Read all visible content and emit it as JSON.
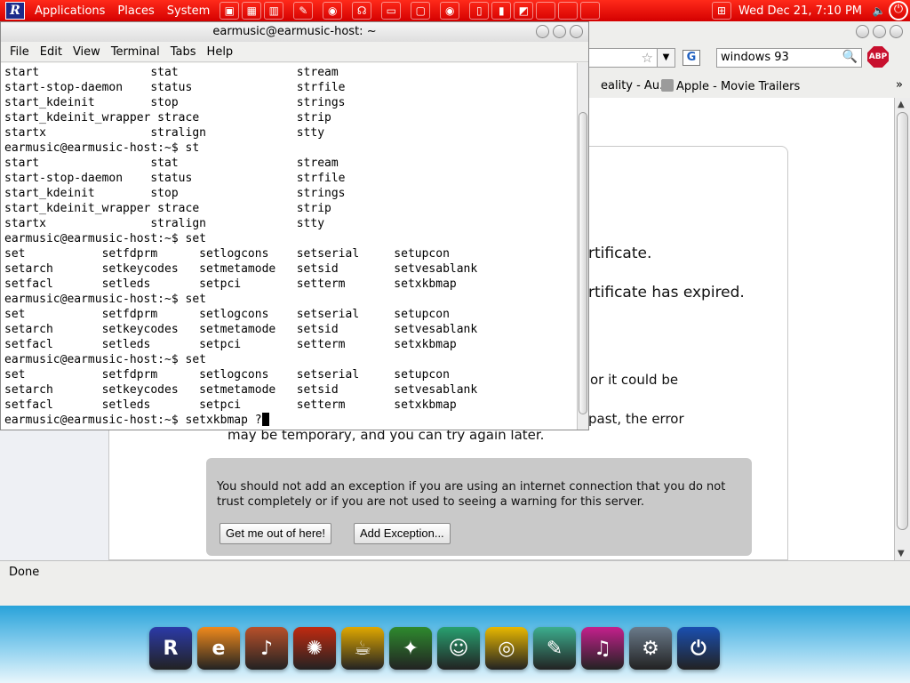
{
  "top_panel": {
    "menus": [
      "Applications",
      "Places",
      "System"
    ],
    "clock": "Wed Dec 21,  7:10 PM",
    "launchers": [
      "screenshot-icon",
      "keyboard-icon",
      "audio-icon",
      "note-icon",
      "firefox-icon",
      "headphones-icon",
      "monitor-icon",
      "window-icon",
      "firefox-icon",
      "paper-icon",
      "trash-icon",
      "document-icon",
      "blank-icon",
      "blank-icon",
      "blank-icon",
      "network-icon",
      "volume-icon"
    ]
  },
  "terminal": {
    "title": "earmusic@earmusic-host: ~",
    "menu": [
      "File",
      "Edit",
      "View",
      "Terminal",
      "Tabs",
      "Help"
    ],
    "lines": [
      "start                stat                 stream",
      "start-stop-daemon    status               strfile",
      "start_kdeinit        stop                 strings",
      "start_kdeinit_wrapper strace              strip",
      "startx               stralign             stty",
      "earmusic@earmusic-host:~$ st",
      "start                stat                 stream",
      "start-stop-daemon    status               strfile",
      "start_kdeinit        stop                 strings",
      "start_kdeinit_wrapper strace              strip",
      "startx               stralign             stty",
      "earmusic@earmusic-host:~$ set",
      "set           setfdprm      setlogcons    setserial     setupcon",
      "setarch       setkeycodes   setmetamode   setsid        setvesablank",
      "setfacl       setleds       setpci        setterm       setxkbmap",
      "earmusic@earmusic-host:~$ set",
      "set           setfdprm      setlogcons    setserial     setupcon",
      "setarch       setkeycodes   setmetamode   setsid        setvesablank",
      "setfacl       setleds       setpci        setterm       setxkbmap",
      "earmusic@earmusic-host:~$ set",
      "set           setfdprm      setlogcons    setserial     setupcon",
      "setarch       setkeycodes   setmetamode   setsid        setvesablank",
      "setfacl       setleds       setpci        setterm       setxkbmap"
    ],
    "prompt_line": "earmusic@earmusic-host:~$ setxkbmap ?"
  },
  "browser": {
    "search_value": "windows 93",
    "search_engine_icon": "G",
    "bookmarks": [
      "eality - Au...",
      "Apple - Movie Trailers"
    ],
    "bookmarks_more": "»",
    "abp_label": "ABP",
    "error_lines": [
      "rtificate.",
      "rtificate has expired.",
      "or it could be",
      "past, the error",
      "may be temporary, and you can try again later."
    ],
    "warning_text": "You should not add an exception if you are using an internet connection that you do not trust completely or if you are not used to seeing a warning for this server.",
    "button_get_out": "Get me out of here!",
    "button_add_exception": "Add Exception...",
    "status": "Done"
  },
  "dock": {
    "icons": [
      {
        "name": "r-logo-icon",
        "glyph": "R",
        "color": "#2b3aa8"
      },
      {
        "name": "browser-icon",
        "glyph": "e",
        "color": "#f08a1c"
      },
      {
        "name": "guitar-icon",
        "glyph": "♪",
        "color": "#b8502a"
      },
      {
        "name": "media-icon",
        "glyph": "✺",
        "color": "#c02a10"
      },
      {
        "name": "coffee-icon",
        "glyph": "☕",
        "color": "#e0a800"
      },
      {
        "name": "game-icon",
        "glyph": "✦",
        "color": "#2e8a2e"
      },
      {
        "name": "messenger-icon",
        "glyph": "☺",
        "color": "#28a070"
      },
      {
        "name": "office-icon",
        "glyph": "◎",
        "color": "#e8b800"
      },
      {
        "name": "pen-icon",
        "glyph": "✎",
        "color": "#3cae8e"
      },
      {
        "name": "music-icon",
        "glyph": "♫",
        "color": "#c4208c"
      },
      {
        "name": "settings-icon",
        "glyph": "⚙",
        "color": "#6a7a8a"
      },
      {
        "name": "power-icon",
        "glyph": "⏻",
        "color": "#1a4fb0"
      }
    ]
  }
}
